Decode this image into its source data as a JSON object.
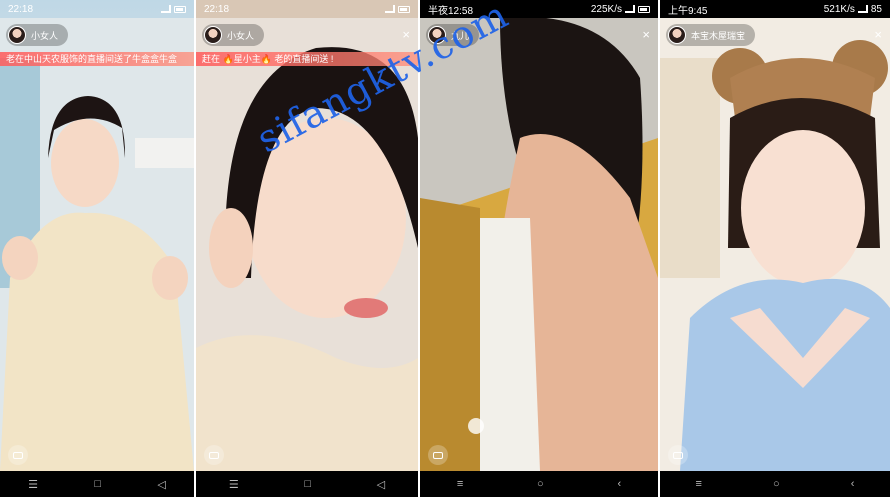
{
  "panels": [
    {
      "status": {
        "time": "22:18",
        "battery": ""
      },
      "streamer_name": "小女人",
      "ticker": "老在中山天农服饰的直播间送了牛盒盒牛盒",
      "show_close": false,
      "nav": [
        "☰",
        "□",
        "◁"
      ]
    },
    {
      "status": {
        "time": "22:18",
        "battery": ""
      },
      "streamer_name": "小女人",
      "ticker": "赶在 🔥星小主🔥 老的直播间送 !",
      "show_close": true,
      "close_label": "×",
      "nav": [
        "☰",
        "□",
        "◁"
      ]
    },
    {
      "status": {
        "time": "半夜12:58",
        "network": "225K/s",
        "battery": ""
      },
      "streamer_name": "九儿",
      "show_close": true,
      "close_label": "×",
      "nav": [
        "≡",
        "○",
        "‹"
      ]
    },
    {
      "status": {
        "time": "上午9:45",
        "network": "521K/s",
        "battery": "85"
      },
      "streamer_name": "本宝木屋瑞宝",
      "show_close": true,
      "close_label": "×",
      "nav": [
        "≡",
        "○",
        "‹"
      ]
    }
  ],
  "watermark": "sifangktv.com",
  "colors": {
    "watermark": "#1f63e8",
    "ticker": "#ff5a5a"
  }
}
